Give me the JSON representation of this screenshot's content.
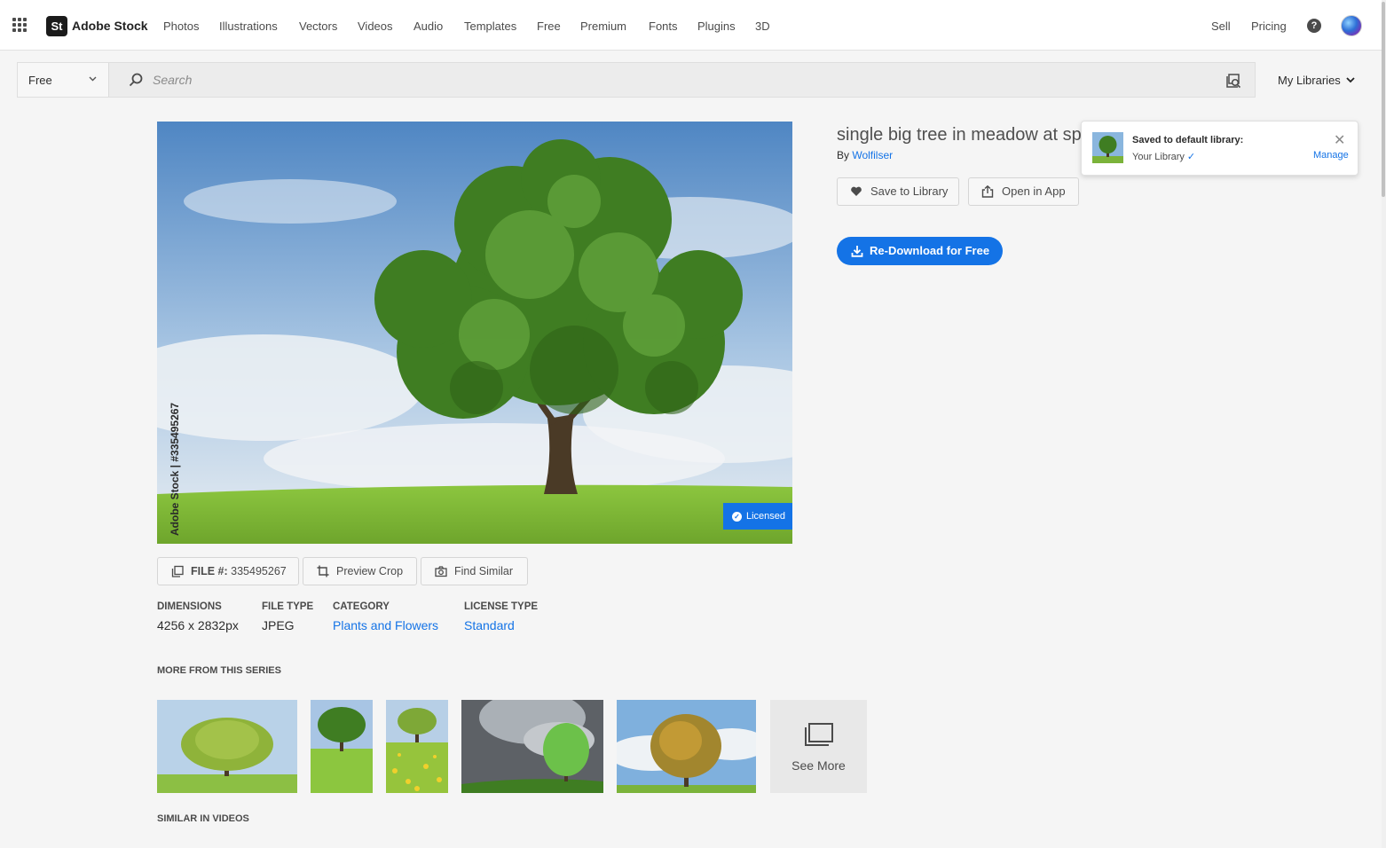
{
  "header": {
    "brand_badge": "St",
    "brand": "Adobe Stock",
    "nav": [
      "Photos",
      "Illustrations",
      "Vectors",
      "Videos",
      "Audio",
      "Templates",
      "Free",
      "Premium",
      "Fonts",
      "Plugins",
      "3D"
    ],
    "sell": "Sell",
    "pricing": "Pricing",
    "help_glyph": "?"
  },
  "search": {
    "filter": "Free",
    "placeholder": "Search",
    "my_libraries": "My Libraries"
  },
  "asset": {
    "title": "single big tree in meadow at spring",
    "by_prefix": "By",
    "author": "Wolfilser",
    "watermark": "Adobe Stock | #335495267",
    "licensed": "Licensed",
    "save_to_library": "Save to Library",
    "open_in_app": "Open in App",
    "redownload": "Re-Download for Free",
    "file_label": "FILE #:",
    "file_number": "335495267",
    "preview_crop": "Preview Crop",
    "find_similar": "Find Similar"
  },
  "toast": {
    "title": "Saved to default library:",
    "library": "Your Library",
    "check": "✓",
    "close": "✕",
    "manage": "Manage"
  },
  "metadata": {
    "dimensions_label": "DIMENSIONS",
    "dimensions_value": "4256 x 2832px",
    "filetype_label": "FILE TYPE",
    "filetype_value": "JPEG",
    "category_label": "CATEGORY",
    "category_value": "Plants and Flowers",
    "license_label": "LICENSE TYPE",
    "license_value": "Standard"
  },
  "sections": {
    "more_from_series": "MORE FROM THIS SERIES",
    "see_more": "See More",
    "similar_in_videos": "SIMILAR IN VIDEOS"
  },
  "colors": {
    "accent": "#1473e6",
    "sky": "#6a9ccd",
    "grass": "#7bb33a",
    "foliage": "#3f7d22"
  }
}
